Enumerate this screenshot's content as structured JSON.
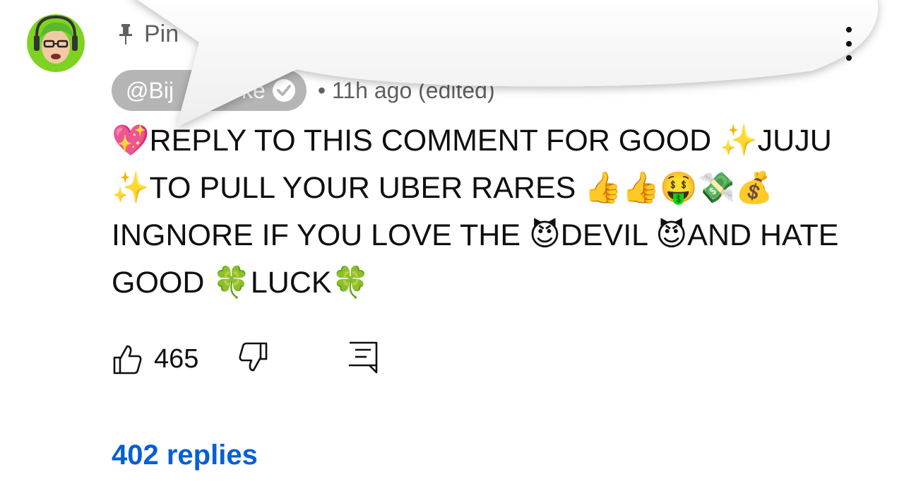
{
  "comment": {
    "pinned_label": "Pin",
    "author_handle": "@Bij",
    "author_suffix": "ke",
    "meta": "• 11h ago (edited)",
    "text": "💖REPLY TO THIS COMMENT FOR GOOD ✨JUJU ✨TO PULL YOUR UBER RARES 👍👍🤑💸💰 INGNORE IF YOU LOVE THE 😈DEVIL 😈AND HATE GOOD 🍀LUCK🍀",
    "like_count": "465",
    "replies_label": "402 replies"
  },
  "icons": {
    "avatar": "avatar",
    "pin": "pin-icon",
    "verified": "verified-check-icon",
    "more": "more-vertical-icon",
    "like": "thumbs-up-icon",
    "dislike": "thumbs-down-icon",
    "reply": "reply-comment-icon"
  },
  "colors": {
    "link": "#065fd4",
    "author_pill": "#b5b5b5",
    "meta": "#606060"
  }
}
